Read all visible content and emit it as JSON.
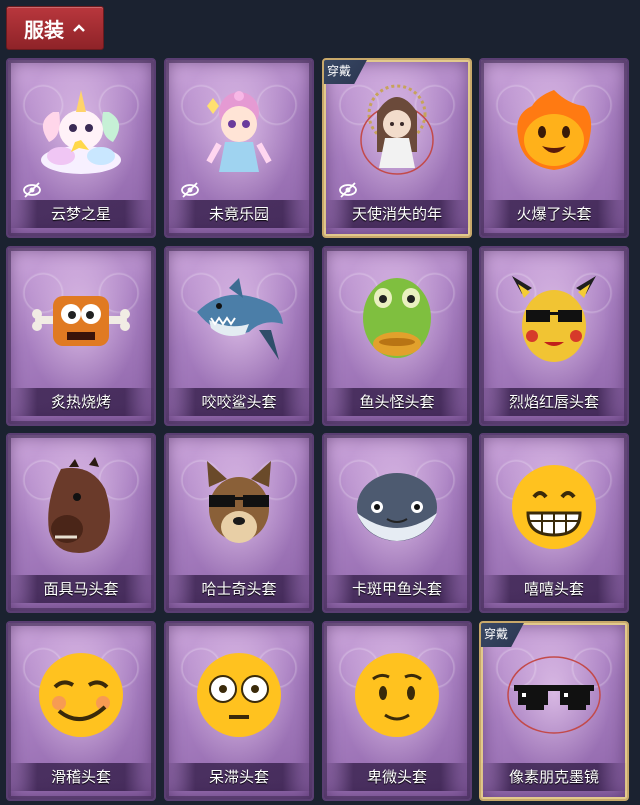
{
  "header": {
    "tab_label": "服装"
  },
  "worn_badge": "穿戴",
  "items": [
    {
      "label": "云梦之星",
      "icon": "unicorn-icon",
      "worn": false,
      "hidden": true
    },
    {
      "label": "未竟乐园",
      "icon": "clown-girl-icon",
      "worn": false,
      "hidden": true
    },
    {
      "label": "天使消失的年",
      "icon": "angel-doll-icon",
      "worn": true,
      "hidden": true
    },
    {
      "label": "火爆了头套",
      "icon": "fire-head-icon",
      "worn": false,
      "hidden": false
    },
    {
      "label": "炙热烧烤",
      "icon": "meat-head-icon",
      "worn": false,
      "hidden": false
    },
    {
      "label": "咬咬鲨头套",
      "icon": "shark-head-icon",
      "worn": false,
      "hidden": false
    },
    {
      "label": "鱼头怪头套",
      "icon": "fish-head-icon",
      "worn": false,
      "hidden": false
    },
    {
      "label": "烈焰红唇头套",
      "icon": "pikachu-head-icon",
      "worn": false,
      "hidden": false
    },
    {
      "label": "面具马头套",
      "icon": "horse-head-icon",
      "worn": false,
      "hidden": false
    },
    {
      "label": "哈士奇头套",
      "icon": "dog-head-icon",
      "worn": false,
      "hidden": false
    },
    {
      "label": "卡斑甲鱼头套",
      "icon": "whale-head-icon",
      "worn": false,
      "hidden": false
    },
    {
      "label": "嘻嘻头套",
      "icon": "grin-emoji-icon",
      "worn": false,
      "hidden": false
    },
    {
      "label": "滑稽头套",
      "icon": "smirk-emoji-icon",
      "worn": false,
      "hidden": false
    },
    {
      "label": "呆滞头套",
      "icon": "stunned-emoji-icon",
      "worn": false,
      "hidden": false
    },
    {
      "label": "卑微头套",
      "icon": "humble-emoji-icon",
      "worn": false,
      "hidden": false
    },
    {
      "label": "像素朋克墨镜",
      "icon": "pixel-sunglasses-icon",
      "worn": true,
      "hidden": false
    }
  ]
}
